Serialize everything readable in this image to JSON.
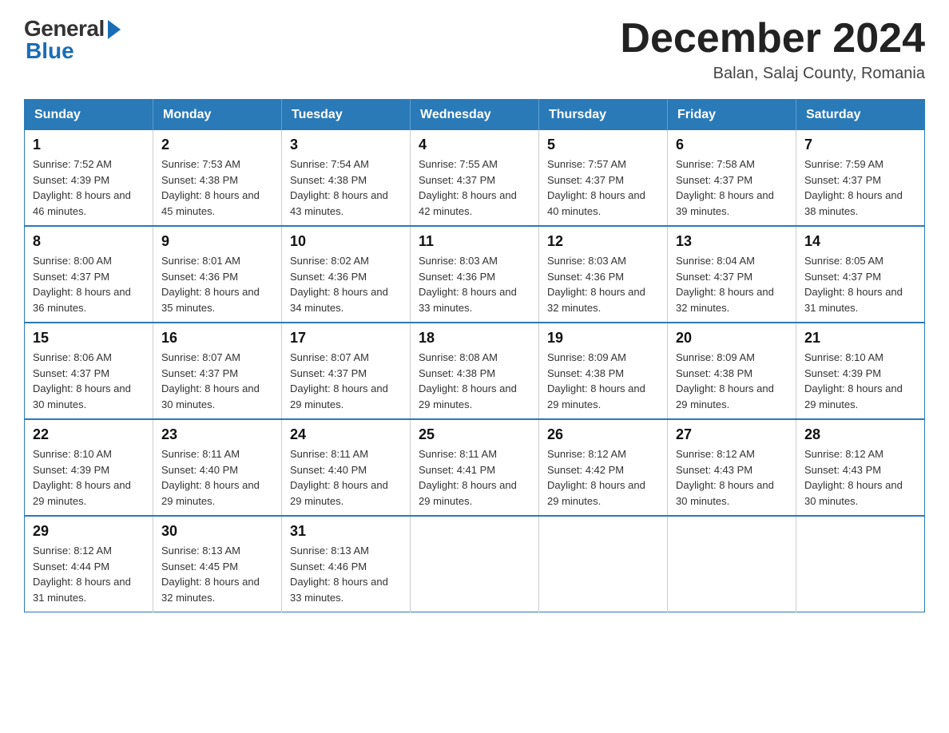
{
  "logo": {
    "general": "General",
    "blue": "Blue"
  },
  "title": {
    "month_year": "December 2024",
    "location": "Balan, Salaj County, Romania"
  },
  "headers": [
    "Sunday",
    "Monday",
    "Tuesday",
    "Wednesday",
    "Thursday",
    "Friday",
    "Saturday"
  ],
  "weeks": [
    [
      {
        "day": "1",
        "sunrise": "7:52 AM",
        "sunset": "4:39 PM",
        "daylight": "8 hours and 46 minutes."
      },
      {
        "day": "2",
        "sunrise": "7:53 AM",
        "sunset": "4:38 PM",
        "daylight": "8 hours and 45 minutes."
      },
      {
        "day": "3",
        "sunrise": "7:54 AM",
        "sunset": "4:38 PM",
        "daylight": "8 hours and 43 minutes."
      },
      {
        "day": "4",
        "sunrise": "7:55 AM",
        "sunset": "4:37 PM",
        "daylight": "8 hours and 42 minutes."
      },
      {
        "day": "5",
        "sunrise": "7:57 AM",
        "sunset": "4:37 PM",
        "daylight": "8 hours and 40 minutes."
      },
      {
        "day": "6",
        "sunrise": "7:58 AM",
        "sunset": "4:37 PM",
        "daylight": "8 hours and 39 minutes."
      },
      {
        "day": "7",
        "sunrise": "7:59 AM",
        "sunset": "4:37 PM",
        "daylight": "8 hours and 38 minutes."
      }
    ],
    [
      {
        "day": "8",
        "sunrise": "8:00 AM",
        "sunset": "4:37 PM",
        "daylight": "8 hours and 36 minutes."
      },
      {
        "day": "9",
        "sunrise": "8:01 AM",
        "sunset": "4:36 PM",
        "daylight": "8 hours and 35 minutes."
      },
      {
        "day": "10",
        "sunrise": "8:02 AM",
        "sunset": "4:36 PM",
        "daylight": "8 hours and 34 minutes."
      },
      {
        "day": "11",
        "sunrise": "8:03 AM",
        "sunset": "4:36 PM",
        "daylight": "8 hours and 33 minutes."
      },
      {
        "day": "12",
        "sunrise": "8:03 AM",
        "sunset": "4:36 PM",
        "daylight": "8 hours and 32 minutes."
      },
      {
        "day": "13",
        "sunrise": "8:04 AM",
        "sunset": "4:37 PM",
        "daylight": "8 hours and 32 minutes."
      },
      {
        "day": "14",
        "sunrise": "8:05 AM",
        "sunset": "4:37 PM",
        "daylight": "8 hours and 31 minutes."
      }
    ],
    [
      {
        "day": "15",
        "sunrise": "8:06 AM",
        "sunset": "4:37 PM",
        "daylight": "8 hours and 30 minutes."
      },
      {
        "day": "16",
        "sunrise": "8:07 AM",
        "sunset": "4:37 PM",
        "daylight": "8 hours and 30 minutes."
      },
      {
        "day": "17",
        "sunrise": "8:07 AM",
        "sunset": "4:37 PM",
        "daylight": "8 hours and 29 minutes."
      },
      {
        "day": "18",
        "sunrise": "8:08 AM",
        "sunset": "4:38 PM",
        "daylight": "8 hours and 29 minutes."
      },
      {
        "day": "19",
        "sunrise": "8:09 AM",
        "sunset": "4:38 PM",
        "daylight": "8 hours and 29 minutes."
      },
      {
        "day": "20",
        "sunrise": "8:09 AM",
        "sunset": "4:38 PM",
        "daylight": "8 hours and 29 minutes."
      },
      {
        "day": "21",
        "sunrise": "8:10 AM",
        "sunset": "4:39 PM",
        "daylight": "8 hours and 29 minutes."
      }
    ],
    [
      {
        "day": "22",
        "sunrise": "8:10 AM",
        "sunset": "4:39 PM",
        "daylight": "8 hours and 29 minutes."
      },
      {
        "day": "23",
        "sunrise": "8:11 AM",
        "sunset": "4:40 PM",
        "daylight": "8 hours and 29 minutes."
      },
      {
        "day": "24",
        "sunrise": "8:11 AM",
        "sunset": "4:40 PM",
        "daylight": "8 hours and 29 minutes."
      },
      {
        "day": "25",
        "sunrise": "8:11 AM",
        "sunset": "4:41 PM",
        "daylight": "8 hours and 29 minutes."
      },
      {
        "day": "26",
        "sunrise": "8:12 AM",
        "sunset": "4:42 PM",
        "daylight": "8 hours and 29 minutes."
      },
      {
        "day": "27",
        "sunrise": "8:12 AM",
        "sunset": "4:43 PM",
        "daylight": "8 hours and 30 minutes."
      },
      {
        "day": "28",
        "sunrise": "8:12 AM",
        "sunset": "4:43 PM",
        "daylight": "8 hours and 30 minutes."
      }
    ],
    [
      {
        "day": "29",
        "sunrise": "8:12 AM",
        "sunset": "4:44 PM",
        "daylight": "8 hours and 31 minutes."
      },
      {
        "day": "30",
        "sunrise": "8:13 AM",
        "sunset": "4:45 PM",
        "daylight": "8 hours and 32 minutes."
      },
      {
        "day": "31",
        "sunrise": "8:13 AM",
        "sunset": "4:46 PM",
        "daylight": "8 hours and 33 minutes."
      },
      null,
      null,
      null,
      null
    ]
  ],
  "labels": {
    "sunrise_prefix": "Sunrise: ",
    "sunset_prefix": "Sunset: ",
    "daylight_prefix": "Daylight: "
  }
}
